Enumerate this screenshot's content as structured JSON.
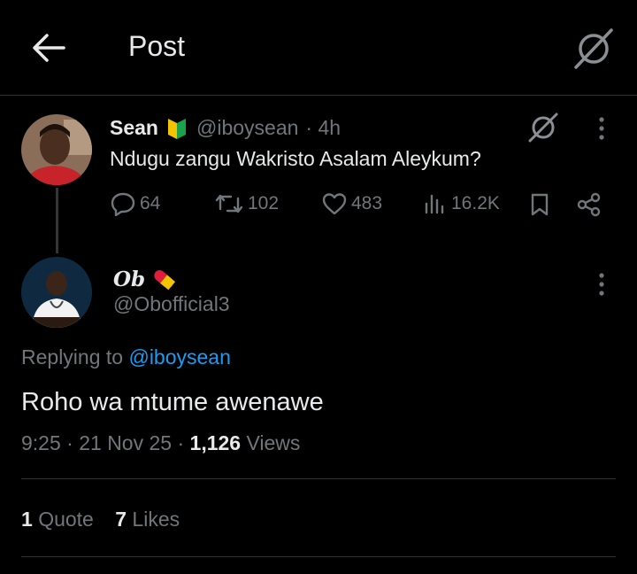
{
  "header": {
    "title": "Post",
    "back_icon": "arrow-left-icon",
    "grok_icon": "grok-icon"
  },
  "original_post": {
    "author_name": "Sean",
    "badge_icon": "shoshinsha-mark-icon",
    "handle": "@iboysean",
    "time": "· 4h",
    "text": "Ndugu zangu Wakristo Asalam Aleykum?",
    "actions": {
      "replies": "64",
      "reposts": "102",
      "likes": "483",
      "views": "16.2K"
    }
  },
  "reply_post": {
    "author_name": "Ob",
    "badge_icon": "pill-icon",
    "handle": "@Obofficial3",
    "replying_prefix": "Replying to",
    "replying_to": "@iboysean",
    "text": "Roho wa mtume awenawe",
    "time": "9:25",
    "date": "21 Nov 25",
    "views_count": "1,126",
    "views_label": "Views",
    "quote_count": "1",
    "quote_label": "Quote",
    "likes_count": "7",
    "likes_label": "Likes"
  },
  "colors": {
    "background": "#000000",
    "text": "#e7e9ea",
    "secondary": "#71767b",
    "link": "#1d9bf0",
    "divider": "#2f3336"
  }
}
